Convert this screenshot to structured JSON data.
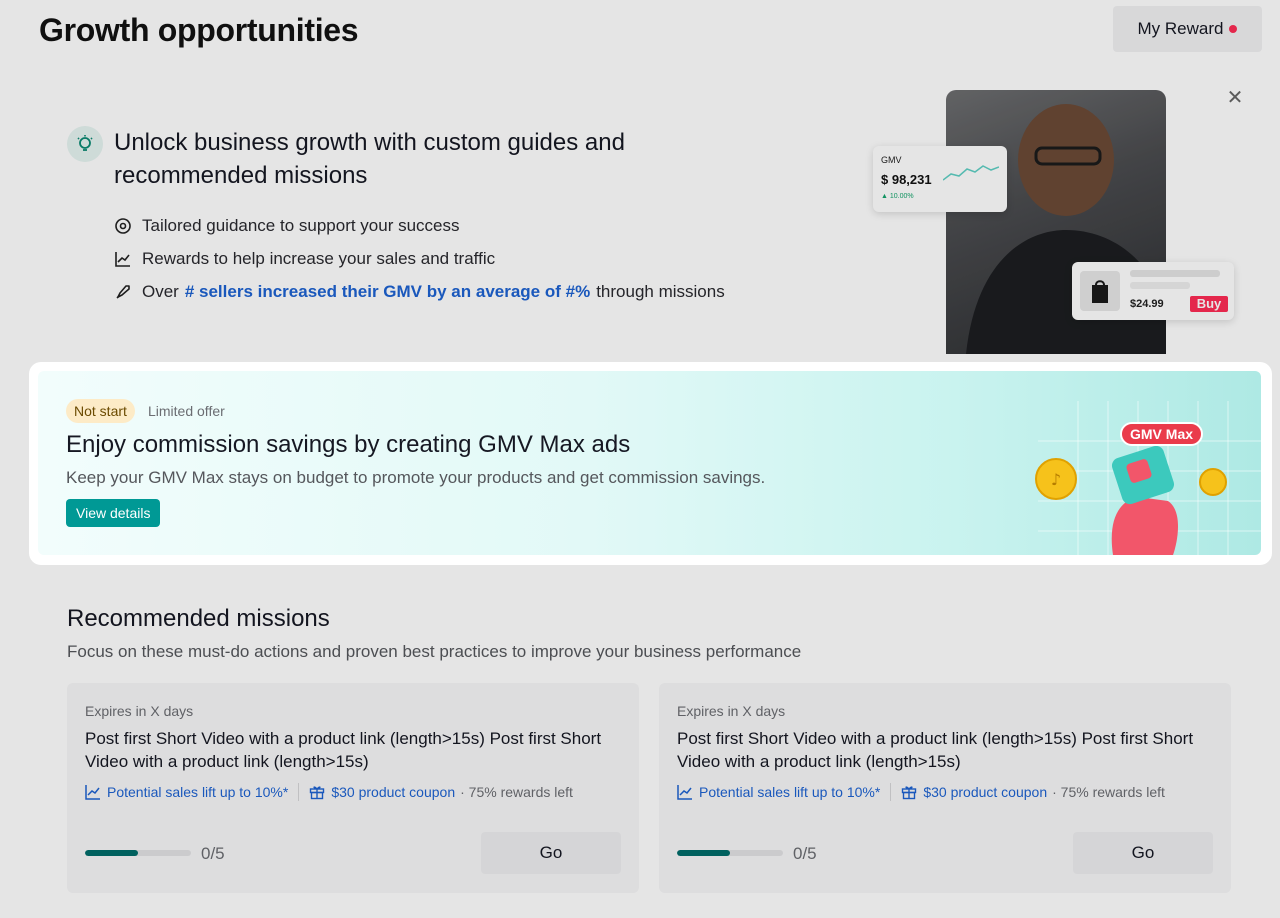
{
  "page": {
    "title": "Growth opportunities",
    "my_reward_label": "My Reward"
  },
  "intro": {
    "title": "Unlock business growth with custom guides and recommended missions",
    "bullets": [
      {
        "icon": "target-icon",
        "text": "Tailored guidance to support your success"
      },
      {
        "icon": "line-chart-icon",
        "text": "Rewards to help increase your sales and traffic"
      }
    ],
    "bullet3": {
      "icon": "rocket-icon",
      "prefix": "Over",
      "highlight": "# sellers increased their GMV by an average of #%",
      "suffix": "through missions"
    },
    "gmv_card": {
      "label": "GMV",
      "value": "$ 98,231",
      "change": "▲ 10.00%"
    },
    "product_card": {
      "price": "$24.99",
      "buy_label": "Buy"
    }
  },
  "offer": {
    "status": "Not start",
    "tag": "Limited offer",
    "title": "Enjoy commission savings by creating GMV Max ads",
    "description": "Keep your GMV Max stays on budget to promote your products and get commission savings.",
    "button": "View details",
    "illustration_tag": "GMV Max"
  },
  "recommended": {
    "title": "Recommended missions",
    "subtitle": "Focus on these must-do actions and proven best practices to improve your business performance",
    "missions": [
      {
        "expires": "Expires in X days",
        "title": "Post first Short Video with a product link (length>15s) Post first Short Video with a product link (length>15s)",
        "benefit": "Potential sales lift up to 10%*",
        "reward": "$30 product coupon",
        "rewards_left": "· 75% rewards left",
        "progress_fraction": 0.5,
        "progress_text": "0/5",
        "action": "Go"
      },
      {
        "expires": "Expires in X days",
        "title": "Post first Short Video with a product link (length>15s) Post first Short Video with a product link (length>15s)",
        "benefit": "Potential sales lift up to 10%*",
        "reward": "$30 product coupon",
        "rewards_left": "· 75% rewards left",
        "progress_fraction": 0.5,
        "progress_text": "0/5",
        "action": "Go"
      }
    ]
  },
  "colors": {
    "accent": "#009995",
    "link": "#1e63d2",
    "alert_dot": "#fe2c55",
    "progress": "#006d6a"
  }
}
